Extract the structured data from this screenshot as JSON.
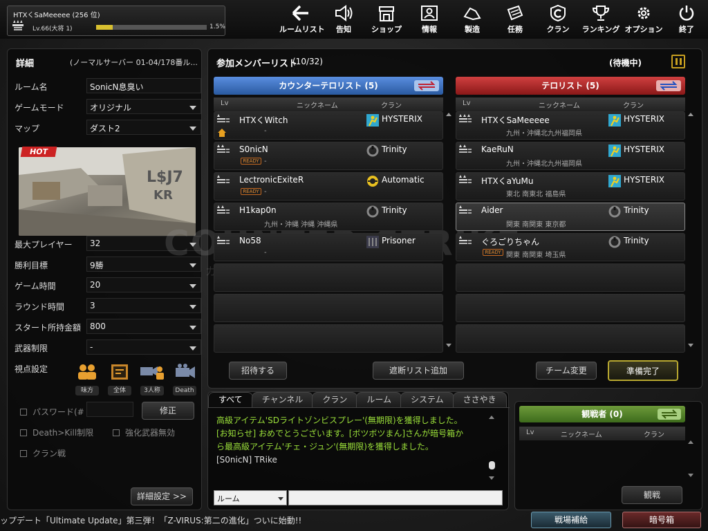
{
  "player": {
    "name": "HTXくSaMeeeee (256 位)",
    "level": "Lv.66(大将 1)",
    "exp_percent": "1.5%",
    "exp_fraction": 0.015
  },
  "nav": [
    {
      "label": "ルームリスト",
      "icon": "back-arrow-icon"
    },
    {
      "label": "告知",
      "icon": "megaphone-icon"
    },
    {
      "label": "ショップ",
      "icon": "shop-icon"
    },
    {
      "label": "情報",
      "icon": "id-card-icon"
    },
    {
      "label": "製造",
      "icon": "crafting-icon"
    },
    {
      "label": "任務",
      "icon": "mission-icon"
    },
    {
      "label": "クラン",
      "icon": "clan-icon"
    },
    {
      "label": "ランキング",
      "icon": "trophy-icon"
    },
    {
      "label": "オプション",
      "icon": "gear-icon"
    },
    {
      "label": "終了",
      "icon": "power-icon"
    }
  ],
  "details": {
    "title": "詳細",
    "server": "(ノーマルサーバー 01-04/178番ル...",
    "room_name_label": "ルーム名",
    "room_name": "SonicN息臭い",
    "mode_label": "ゲームモード",
    "mode": "オリジナル",
    "map_label": "マップ",
    "map": "ダスト2",
    "hot_badge": "HOT",
    "map_text_1": "L$J7",
    "map_text_2": "KR",
    "max_players_label": "最大プレイヤー",
    "max_players": "32",
    "win_label": "勝利目標",
    "win": "9勝",
    "time_label": "ゲーム時間",
    "time": "20",
    "round_label": "ラウンド時間",
    "round": "3",
    "money_label": "スタート所持金額",
    "money": "800",
    "weapon_label": "武器制限",
    "weapon": "-",
    "view_label": "視点設定",
    "views": [
      "味方",
      "全体",
      "3人称",
      "Death"
    ],
    "password_label": "パスワード(#",
    "modify_button": "修正",
    "death_kill_label": "Death>Kill制限",
    "enhance_label": "強化武器無効",
    "clan_war_label": "クラン戦",
    "advanced_button": "詳細設定 >>"
  },
  "members": {
    "title": "参加メンバーリスト",
    "count": "(10/32)",
    "status": "(待機中)",
    "columns": {
      "lv": "Lv",
      "nick": "ニックネーム",
      "clan": "クラン"
    },
    "ct": {
      "title": "カウンターテロリスト (5)",
      "rows": [
        {
          "nick": "HTXくWitch",
          "loc": "-",
          "clan": "HYSTERIX",
          "ready": false
        },
        {
          "nick": "S0nicN",
          "loc": "-",
          "clan": "Trinity",
          "ready": true
        },
        {
          "nick": "LectronicExiteR",
          "loc": "-",
          "clan": "Automatic",
          "ready": true
        },
        {
          "nick": "H1kap0n",
          "loc": "九州・沖縄 沖縄 沖縄県",
          "clan": "Trinity",
          "ready": false
        },
        {
          "nick": "No58",
          "loc": "-",
          "clan": "Prisoner",
          "ready": false
        }
      ]
    },
    "t": {
      "title": "テロリスト (5)",
      "rows": [
        {
          "nick": "HTXくSaMeeeee",
          "loc": "九州・沖縄北九州福岡県",
          "clan": "HYSTERIX",
          "ready": false
        },
        {
          "nick": "KaeRuN",
          "loc": "九州・沖縄北九州福岡県",
          "clan": "HYSTERIX",
          "ready": false
        },
        {
          "nick": "HTXくaYuMu",
          "loc": "東北 南東北 福島県",
          "clan": "HYSTERIX",
          "ready": false
        },
        {
          "nick": "Aider",
          "loc": "関東 南関東 東京都",
          "clan": "Trinity",
          "ready": false
        },
        {
          "nick": "ぐろごりちゃん",
          "loc": "関東 南関東 埼玉県",
          "clan": "Trinity",
          "ready": true
        }
      ]
    },
    "ready_tag": "READY",
    "invite_button": "招待する",
    "block_button": "遮断リスト追加",
    "team_change_button": "チーム変更",
    "ready_button": "準備完了"
  },
  "watermark": {
    "main": "COUNTER-STRIKE",
    "sub": "カウンターストライクオンライン"
  },
  "chat": {
    "tabs": [
      "すべて",
      "チャンネル",
      "クラン",
      "ルーム",
      "システム",
      "ささやき"
    ],
    "lines": [
      "高級アイテム'SDライトゾンビスプレー'(無期限)を獲得しました。",
      "[お知らせ] おめでとうございます。[ボツボツまん]さんが暗号箱か",
      "ら最高級アイテム'チェ・ジュン'(無期限)を獲得しました。",
      "[S0nicN] TRike"
    ],
    "channel": "ルーム",
    "input": ""
  },
  "spectators": {
    "title": "観戦者 (0)",
    "button": "観戦"
  },
  "ticker": "ップデート「Ultimate Update」第三弾！「Z-VIRUS:第二の進化」ついに始動!!",
  "bottom": {
    "supply": "戦場補給",
    "cryptobox": "暗号箱"
  },
  "colors": {
    "ct": "#3a6fc0",
    "t": "#b02a2a",
    "accent": "#c9a020",
    "chat_green": "#9be03a"
  }
}
